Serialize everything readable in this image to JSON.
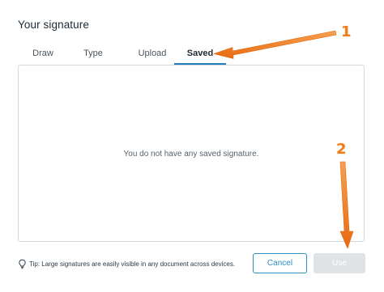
{
  "dialog": {
    "title": "Your signature"
  },
  "tabs": [
    {
      "label": "Draw",
      "active": false
    },
    {
      "label": "Type",
      "active": false
    },
    {
      "label": "Upload",
      "active": false
    },
    {
      "label": "Saved",
      "active": true
    }
  ],
  "panel": {
    "empty_message": "You do not have any saved signature."
  },
  "tip": {
    "icon": "lightbulb-icon",
    "text": "Tip: Large signatures are easily visible in any document across devices."
  },
  "buttons": {
    "cancel_label": "Cancel",
    "use_label": "Use",
    "use_disabled": true
  },
  "annotations": {
    "step1_label": "1",
    "step2_label": "2",
    "color": "#f07d1c"
  },
  "colors": {
    "accent": "#1f7fc1",
    "cancel_border": "#2d8fc4",
    "disabled_button": "#dfe3e6"
  }
}
